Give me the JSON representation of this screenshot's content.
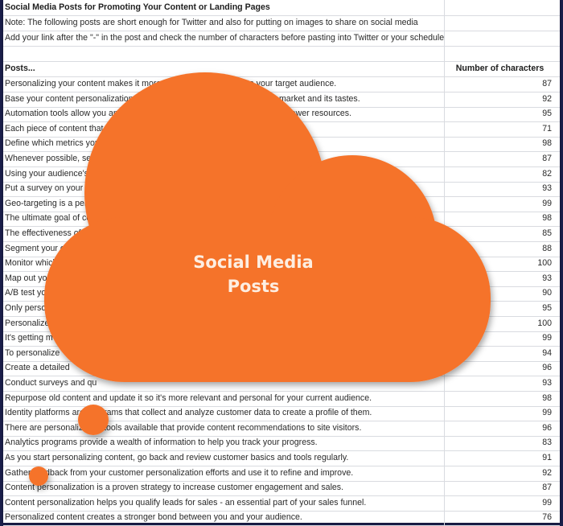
{
  "sheet": {
    "title": "Social Media Posts for Promoting Your Content or Landing Pages",
    "note": "Note: The following posts are short enough for Twitter and also for putting on images to share on social media",
    "instruction": "Add your link after the \"-\" in the post and check the number of characters before pasting into Twitter or your scheduler.",
    "columns": {
      "posts": "Posts...",
      "characters": "Number of characters"
    },
    "rows": [
      {
        "post": "Personalizing your content makes it more valuable and relevant to your target audience.",
        "chars": "87"
      },
      {
        "post": "Base your content personalization on objective knowledge of your target market and its tastes.",
        "chars": "92"
      },
      {
        "post": "Automation tools allow you an easy way to personalize content while using fewer resources.",
        "chars": "95"
      },
      {
        "post": "Each piece of content that you",
        "chars": "71"
      },
      {
        "post": "Define which metrics you'll use to determine if your content is working or not.",
        "chars": "98"
      },
      {
        "post": "Whenever possible, send personalized and useful content.",
        "chars": "87"
      },
      {
        "post": "Using your audience's na",
        "chars": "82"
      },
      {
        "post": "Put a survey on your site",
        "chars": "93"
      },
      {
        "post": "Geo-targeting is a perso",
        "chars": "99"
      },
      {
        "post": "The ultimate goal of con",
        "chars": "98"
      },
      {
        "post": "The effectiveness of con",
        "chars": "85"
      },
      {
        "post": "Segment your em",
        "chars": "88"
      },
      {
        "post": "Monitor which",
        "chars": "100"
      },
      {
        "post": "Map out you",
        "chars": "93"
      },
      {
        "post": "A/B test yo",
        "chars": "90"
      },
      {
        "post": "Only perso",
        "chars": "95"
      },
      {
        "post": "Personalize",
        "chars": "100"
      },
      {
        "post": "It's getting m",
        "chars": "99"
      },
      {
        "post": "To personalize",
        "chars": "94"
      },
      {
        "post": "Create a detailed",
        "chars": "96"
      },
      {
        "post": "Conduct surveys and qu",
        "chars": "93"
      },
      {
        "post": "Repurpose old content and update it so it's more relevant and personal for your current audience.",
        "chars": "98"
      },
      {
        "post": "Identity platforms are programs that collect and analyze customer data to create a profile of them.",
        "chars": "99"
      },
      {
        "post": "There are personalization tools available that provide content recommendations to site visitors.",
        "chars": "96"
      },
      {
        "post": "Analytics programs provide a wealth of information to help you track your progress.",
        "chars": "83"
      },
      {
        "post": "As you start personalizing content, go back and review customer basics and tools regularly.",
        "chars": "91"
      },
      {
        "post": "Gather feedback from your customer personalization efforts and use it to refine and improve.",
        "chars": "92"
      },
      {
        "post": "Content personalization is a proven strategy to increase customer engagement and sales.",
        "chars": "87"
      },
      {
        "post": "Content personalization helps you qualify leads for sales - an essential part of your sales funnel.",
        "chars": "99"
      },
      {
        "post": "Personalized content creates a stronger bond between you and your audience.",
        "chars": "76"
      }
    ]
  },
  "overlay": {
    "line1": "Social Media",
    "line2": "Posts",
    "color": "#f5732b"
  }
}
